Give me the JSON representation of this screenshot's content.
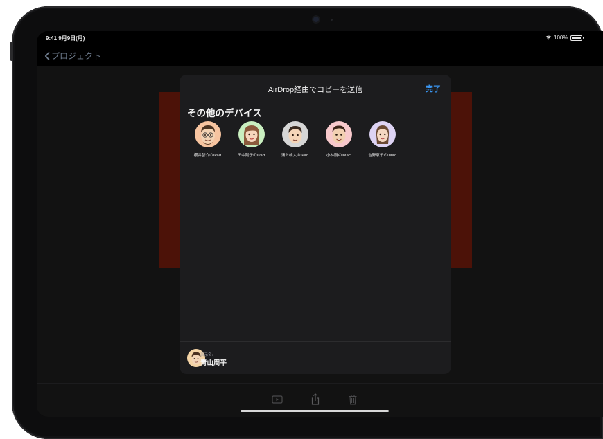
{
  "status_bar": {
    "time": "9:41",
    "date": "9月9日(月)",
    "battery": "100%"
  },
  "nav": {
    "back_label": "プロジェクト"
  },
  "airdrop_sheet": {
    "title": "AirDrop経由でコピーを送信",
    "done_label": "完了",
    "section_title": "その他のデバイス",
    "devices": [
      {
        "name": "櫻井啓介のiPad",
        "avatar_bg": "#f7c4a0"
      },
      {
        "name": "田中陽子のiPad",
        "avatar_bg": "#c9efc0"
      },
      {
        "name": "溝上雄大のiPad",
        "avatar_bg": "#d6d6d6"
      },
      {
        "name": "小林剛のiMac",
        "avatar_bg": "#f8c9cc"
      },
      {
        "name": "吉野恵子のiMac",
        "avatar_bg": "#ddd3f4"
      }
    ],
    "display_name_label": "表示名:",
    "display_name": "青山周平"
  },
  "toolbar": {
    "icons": [
      "play-icon",
      "share-icon",
      "trash-icon"
    ]
  },
  "colors": {
    "accent": "#3a95f0",
    "sheet_bg": "#1c1c1e",
    "slide_bg": "#4c1208"
  }
}
